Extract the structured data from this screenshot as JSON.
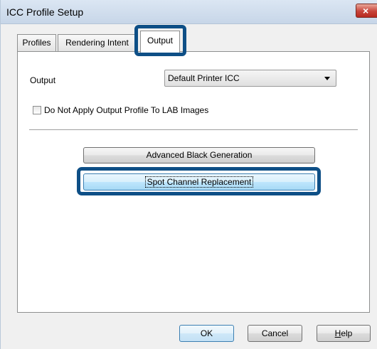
{
  "window": {
    "title": "ICC Profile Setup",
    "close_glyph": "×"
  },
  "tabs": [
    {
      "label": "Profiles",
      "selected": false
    },
    {
      "label": "Rendering Intent",
      "selected": false
    },
    {
      "label": "Output",
      "selected": true
    }
  ],
  "output_section": {
    "label": "Output",
    "dropdown_value": "Default Printer ICC",
    "checkbox_label": "Do Not Apply Output Profile To LAB Images",
    "checkbox_checked": false
  },
  "buttons": {
    "advanced_black": "Advanced Black Generation",
    "spot_channel": "Spot Channel Replacement",
    "ok": "OK",
    "cancel": "Cancel",
    "help_first": "H",
    "help_rest": "elp"
  },
  "colors": {
    "highlight": "#0e4f86"
  }
}
